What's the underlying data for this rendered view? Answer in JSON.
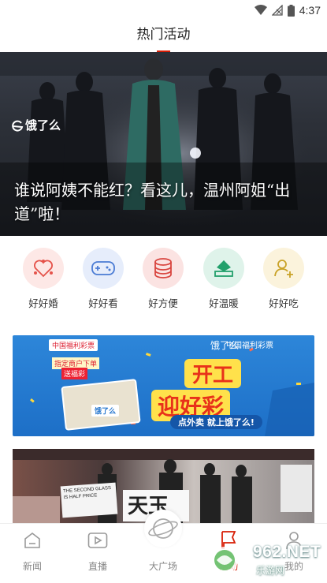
{
  "status_bar": {
    "time": "4:37"
  },
  "header": {
    "title": "热门活动"
  },
  "hero": {
    "logo_text": "饿了么",
    "caption": "谁说阿姨不能红？看这儿，温州阿姐“出道”啦！"
  },
  "categories": [
    {
      "label": "好好婚",
      "icon": "heart-network-icon",
      "color": "#e5534b"
    },
    {
      "label": "好好看",
      "icon": "gamepad-icon",
      "color": "#4a7bd4"
    },
    {
      "label": "好方便",
      "icon": "database-icon",
      "color": "#d9453f"
    },
    {
      "label": "好温暖",
      "icon": "tray-icon",
      "color": "#22a06b"
    },
    {
      "label": "好好吃",
      "icon": "user-add-icon",
      "color": "#c9a227"
    }
  ],
  "banner": {
    "brand": "饿了么",
    "partner": "中国福利彩票",
    "headline_1": "开工",
    "headline_2": "迎好彩",
    "sub": "点外卖 就上饿了么!",
    "tag_1": "中国福利彩票",
    "tag_2": "指定商户下单",
    "tag_3": "送福彩",
    "box_logo": "饿了么"
  },
  "photo2": {
    "sign_1": "THE SECOND GLASS IS HALF PRICE",
    "sign_2": "天玉"
  },
  "bottom_nav": [
    {
      "label": "新闻",
      "icon": "house-icon"
    },
    {
      "label": "直播",
      "icon": "video-icon"
    },
    {
      "label": "大广场",
      "icon": "planet-icon"
    },
    {
      "label": "活动",
      "icon": "flag-icon"
    },
    {
      "label": "我的",
      "icon": "person-icon"
    }
  ],
  "watermark": {
    "text": "962.NET",
    "sub": "乐游网"
  }
}
